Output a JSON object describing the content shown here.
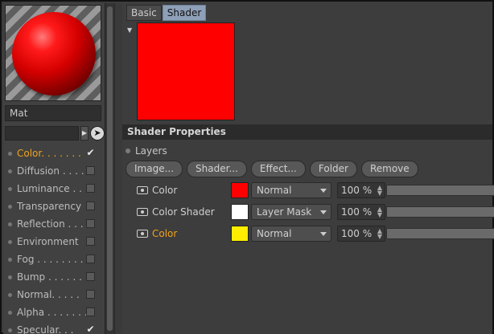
{
  "material": {
    "name": "Mat",
    "preview_colors": {
      "sphere": "#e00000",
      "stripe_light": "#9a9a9a",
      "stripe_dark": "#5e5e5e"
    }
  },
  "channels": [
    {
      "label": "Color",
      "dots": ". . . . . . .",
      "checked": true,
      "active": true
    },
    {
      "label": "Diffusion",
      "dots": ". . . .",
      "checked": false,
      "active": false
    },
    {
      "label": "Luminance",
      "dots": ". . .",
      "checked": false,
      "active": false
    },
    {
      "label": "Transparency",
      "dots": "",
      "checked": false,
      "active": false
    },
    {
      "label": "Reflection",
      "dots": ". . .",
      "checked": false,
      "active": false
    },
    {
      "label": "Environment",
      "dots": "",
      "checked": false,
      "active": false
    },
    {
      "label": "Fog",
      "dots": ". . . . . . . . . .",
      "checked": false,
      "active": false
    },
    {
      "label": "Bump",
      "dots": ". . . . . . . .",
      "checked": false,
      "active": false
    },
    {
      "label": "Normal",
      "dots": ". . . . .",
      "checked": false,
      "active": false
    },
    {
      "label": "Alpha",
      "dots": ". . . . . . .",
      "checked": false,
      "active": false
    },
    {
      "label": "Specular",
      "dots": ". . .",
      "checked": true,
      "active": false
    }
  ],
  "tabs": [
    {
      "label": "Basic",
      "selected": false
    },
    {
      "label": "Shader",
      "selected": true
    }
  ],
  "shader_color": "#ff0000",
  "section_title": "Shader Properties",
  "layers_label": "Layers",
  "buttons": {
    "image": "Image...",
    "shader": "Shader...",
    "effect": "Effect...",
    "folder": "Folder",
    "remove": "Remove"
  },
  "layers": [
    {
      "name": "Color",
      "color": "#ff0000",
      "blend": "Normal",
      "percent": "100 %",
      "highlight": false
    },
    {
      "name": "Color Shader",
      "color": "#ffffff",
      "blend": "Layer Mask",
      "percent": "100 %",
      "highlight": false
    },
    {
      "name": "Color",
      "color": "#ffee00",
      "blend": "Normal",
      "percent": "100 %",
      "highlight": true
    }
  ],
  "accent_color": "#f2a31c"
}
